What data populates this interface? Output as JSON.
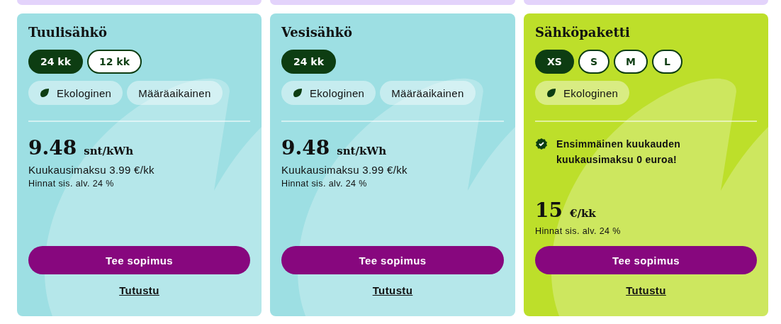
{
  "cards": [
    {
      "color": "#9ddfe3",
      "title": "Tuulisähkö",
      "options": [
        {
          "label": "24 kk",
          "selected": true
        },
        {
          "label": "12 kk",
          "selected": false
        }
      ],
      "tags": [
        {
          "label": "Ekologinen",
          "eco": true
        },
        {
          "label": "Määräaikainen",
          "eco": false
        }
      ],
      "price": "9.48",
      "unit": "snt/kWh",
      "monthly_fee": "Kuukausimaksu 3.99 €/kk",
      "vat": "Hinnat sis. alv. 24 %",
      "button": "Tee sopimus",
      "link": "Tutustu"
    },
    {
      "color": "#9ddfe3",
      "title": "Vesisähkö",
      "options": [
        {
          "label": "24 kk",
          "selected": true
        }
      ],
      "tags": [
        {
          "label": "Ekologinen",
          "eco": true
        },
        {
          "label": "Määräaikainen",
          "eco": false
        }
      ],
      "price": "9.48",
      "unit": "snt/kWh",
      "monthly_fee": "Kuukausimaksu 3.99 €/kk",
      "vat": "Hinnat sis. alv. 24 %",
      "button": "Tee sopimus",
      "link": "Tutustu"
    },
    {
      "color": "#bddf2a",
      "title": "Sähköpaketti",
      "options": [
        {
          "label": "XS",
          "selected": true
        },
        {
          "label": "S",
          "selected": false
        },
        {
          "label": "M",
          "selected": false
        },
        {
          "label": "L",
          "selected": false
        }
      ],
      "tags": [
        {
          "label": "Ekologinen",
          "eco": true
        }
      ],
      "note": "Ensimmäinen kuukauden kuukausimaksu 0 euroa!",
      "price": "15",
      "unit": "€/kk",
      "vat": "Hinnat sis. alv. 24 %",
      "button": "Tee sopimus",
      "link": "Tutustu"
    }
  ]
}
